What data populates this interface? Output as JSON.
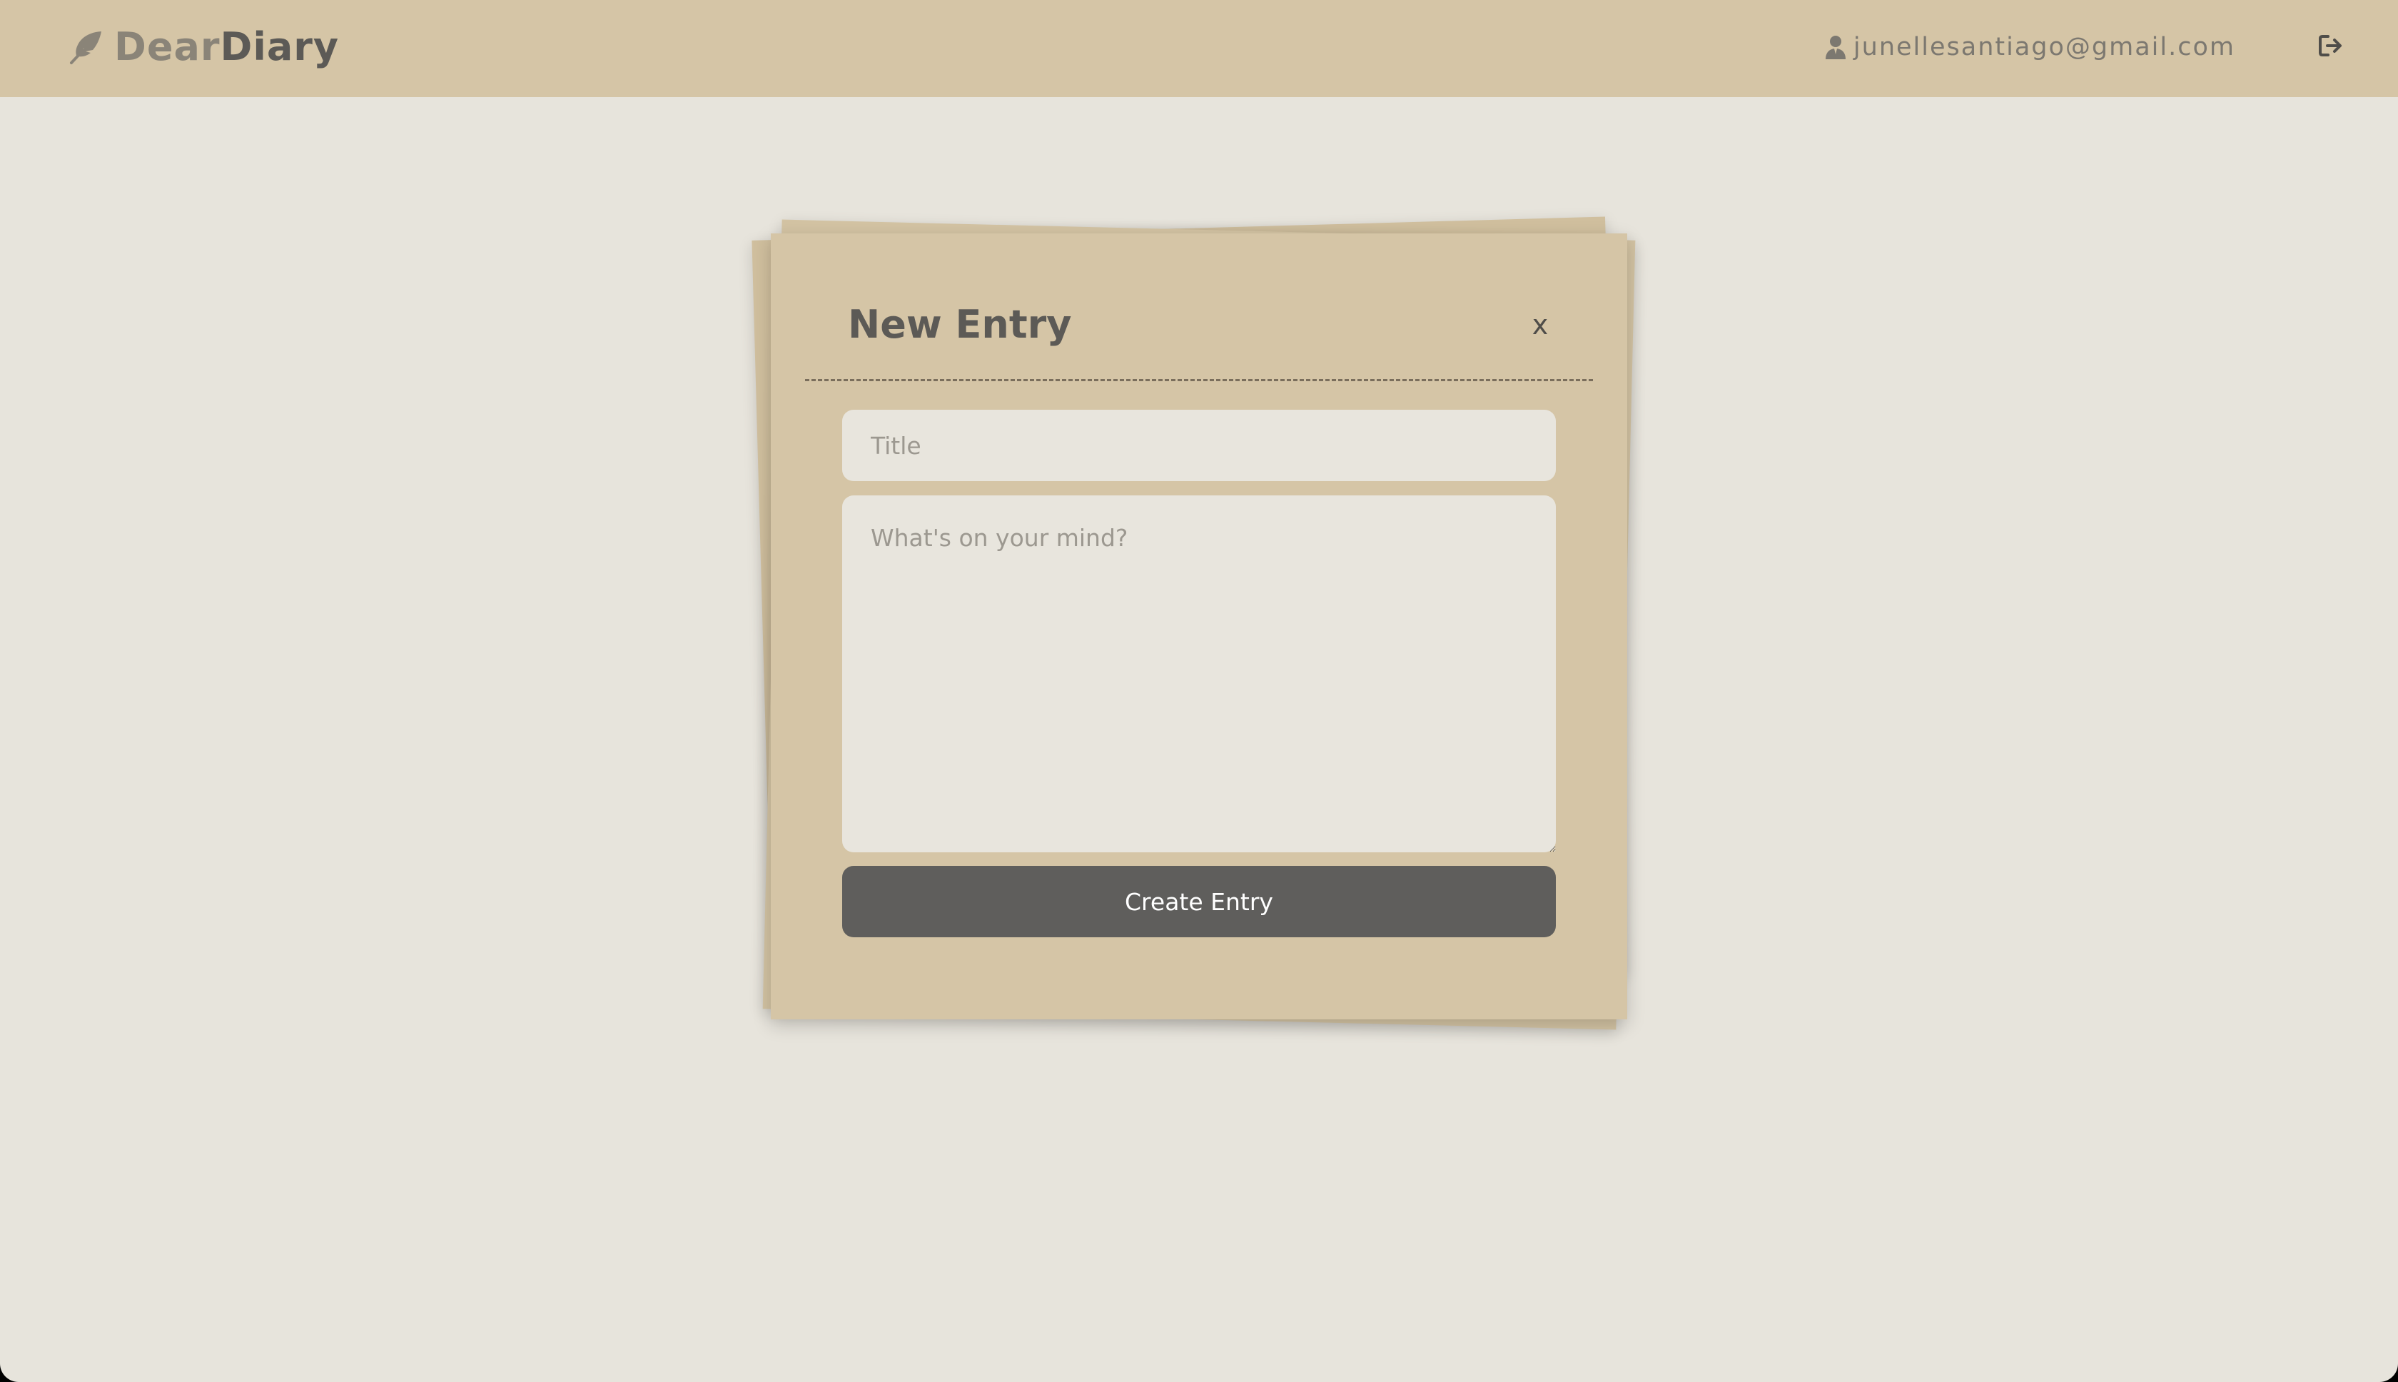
{
  "header": {
    "brand": {
      "icon": "feather-icon",
      "part1": "Dear",
      "part2": "Diary"
    },
    "user": {
      "icon": "user-icon",
      "email": "junellesantiago@gmail.com"
    },
    "logout_icon": "sign-out-icon"
  },
  "modal": {
    "title": "New Entry",
    "close_label": "x",
    "title_placeholder": "Title",
    "body_placeholder": "What's on your mind?",
    "submit_label": "Create Entry"
  },
  "colors": {
    "header_bg": "#d5c5a6",
    "page_bg": "#e7e4dc",
    "paper": "#d5c5a6",
    "field_bg": "#e8e5dd",
    "button_bg": "#5f5e5c",
    "text_dark": "#5c5a56",
    "text_muted": "#8a8478"
  }
}
